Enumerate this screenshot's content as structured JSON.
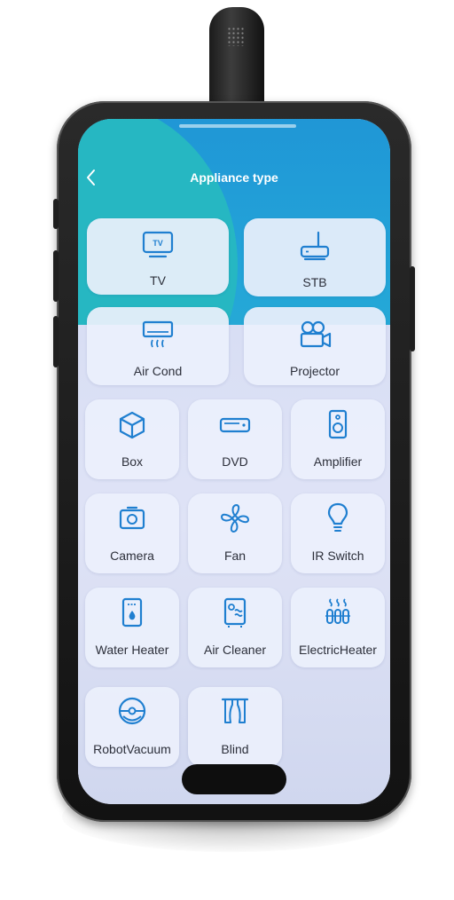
{
  "header": {
    "title": "Appliance type",
    "back_icon": "chevron-left-icon"
  },
  "appliances": [
    {
      "label": "TV",
      "icon": "tv-icon"
    },
    {
      "label": "STB",
      "icon": "router-icon"
    },
    {
      "label": "Air Cond",
      "icon": "air-conditioner-icon"
    },
    {
      "label": "Projector",
      "icon": "projector-icon"
    },
    {
      "label": "Box",
      "icon": "box-icon"
    },
    {
      "label": "DVD",
      "icon": "dvd-player-icon"
    },
    {
      "label": "Amplifier",
      "icon": "speaker-icon"
    },
    {
      "label": "Camera",
      "icon": "camera-icon"
    },
    {
      "label": "Fan",
      "icon": "fan-icon"
    },
    {
      "label": "IR Switch",
      "icon": "lightbulb-icon"
    },
    {
      "label": "Water Heater",
      "icon": "water-heater-icon"
    },
    {
      "label": "Air Cleaner",
      "icon": "air-cleaner-icon"
    },
    {
      "label": "ElectricHeater",
      "icon": "heater-icon"
    },
    {
      "label": "RobotVacuum",
      "icon": "robot-vacuum-icon"
    },
    {
      "label": "Blind",
      "icon": "blind-icon"
    }
  ],
  "colors": {
    "accent": "#1f7fd0",
    "header_blue": "#1f94d6",
    "header_teal": "#26b7c2",
    "card": "#ecf0fc",
    "label_text": "#2c2f3a"
  }
}
